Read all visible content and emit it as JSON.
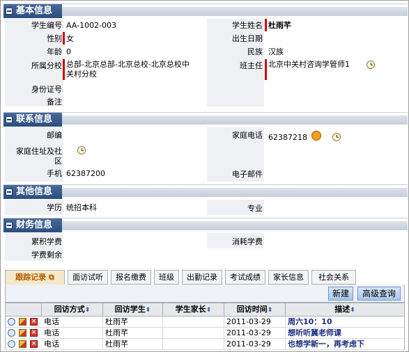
{
  "sections": {
    "basic": "基本信息",
    "contact": "联系信息",
    "other": "其他信息",
    "finance": "财务信息"
  },
  "basic": {
    "student_no_label": "学生编号",
    "student_no": "AA-1002-003",
    "name_label": "学生姓名",
    "name": "杜雨芊",
    "gender_label": "性别",
    "gender": "女",
    "birth_label": "出生日期",
    "birth": "",
    "age_label": "年龄",
    "age": "0",
    "ethnic_label": "民族",
    "ethnic": "汉族",
    "campus_label": "所属分校",
    "campus_line1": "总部-北京总部-北京总校-北京总校中",
    "campus_line2": "关村分校",
    "teacher_label": "班主任",
    "teacher": "北京中关村咨询学管师1",
    "id_label": "身份证号",
    "id": "",
    "note_label": "备注",
    "note": ""
  },
  "contact": {
    "zip_label": "邮编",
    "zip": "",
    "home_phone_label": "家庭电话",
    "home_phone": "62387218",
    "address_label_line1": "家庭住址及社",
    "address_label_line2": "区",
    "mobile_label": "手机",
    "mobile": "62387200",
    "email_label": "电子邮件",
    "email": ""
  },
  "other": {
    "edu_label": "学历",
    "edu": "统招本科",
    "major_label": "专业",
    "major": ""
  },
  "finance": {
    "total_label": "累积学费",
    "total": "",
    "used_label": "消耗学费",
    "used": "",
    "remain_label": "学费剩余",
    "remain": ""
  },
  "tabs": [
    "跟踪记录",
    "面访试听",
    "报名缴费",
    "班级",
    "出勤记录",
    "考试成绩",
    "家长信息",
    "社会关系"
  ],
  "toolbar": {
    "new": "新建",
    "advanced_search": "高级查询"
  },
  "grid": {
    "columns": [
      "回访方式",
      "回访学生",
      "学生家长",
      "回访时间",
      "描述"
    ],
    "rows": [
      {
        "method": "电话",
        "student": "杜雨芊",
        "parent": "",
        "time": "2011-03-29",
        "desc": "周六10：10"
      },
      {
        "method": "电话",
        "student": "杜雨芊",
        "parent": "",
        "time": "2011-03-29",
        "desc": "想听听冀老师课"
      },
      {
        "method": "电话",
        "student": "杜雨芊",
        "parent": "",
        "time": "2011-03-29",
        "desc": "也想学新一，再考虑下"
      }
    ]
  }
}
